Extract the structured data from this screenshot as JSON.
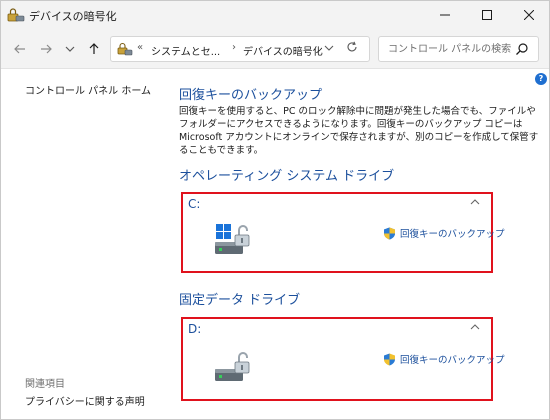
{
  "window": {
    "title": "デバイスの暗号化"
  },
  "address": {
    "chevrons": "«",
    "crumb1": "システムとセ...",
    "crumb2": "デバイスの暗号化"
  },
  "search": {
    "placeholder": "コントロール パネルの検索"
  },
  "sidebar": {
    "home": "コントロール パネル ホーム",
    "related_header": "関連項目",
    "privacy": "プライバシーに関する声明"
  },
  "main": {
    "heading": "回復キーのバックアップ",
    "description": "回復キーを使用すると、PC のロック解除中に問題が発生した場合でも、ファイルやフォルダーにアクセスできるようになります。回復キーのバックアップ コピーは Microsoft アカウントにオンラインで保存されますが、別のコピーを作成して保管することもできます。",
    "os_heading": "オペレーティング システム ドライブ",
    "fixed_heading": "固定データ ドライブ"
  },
  "drives": [
    {
      "letter": "C:",
      "link": "回復キーのバックアップ"
    },
    {
      "letter": "D:",
      "link": "回復キーのバックアップ"
    }
  ],
  "colors": {
    "accent": "#1b4f9c",
    "highlight": "#e0121d"
  }
}
